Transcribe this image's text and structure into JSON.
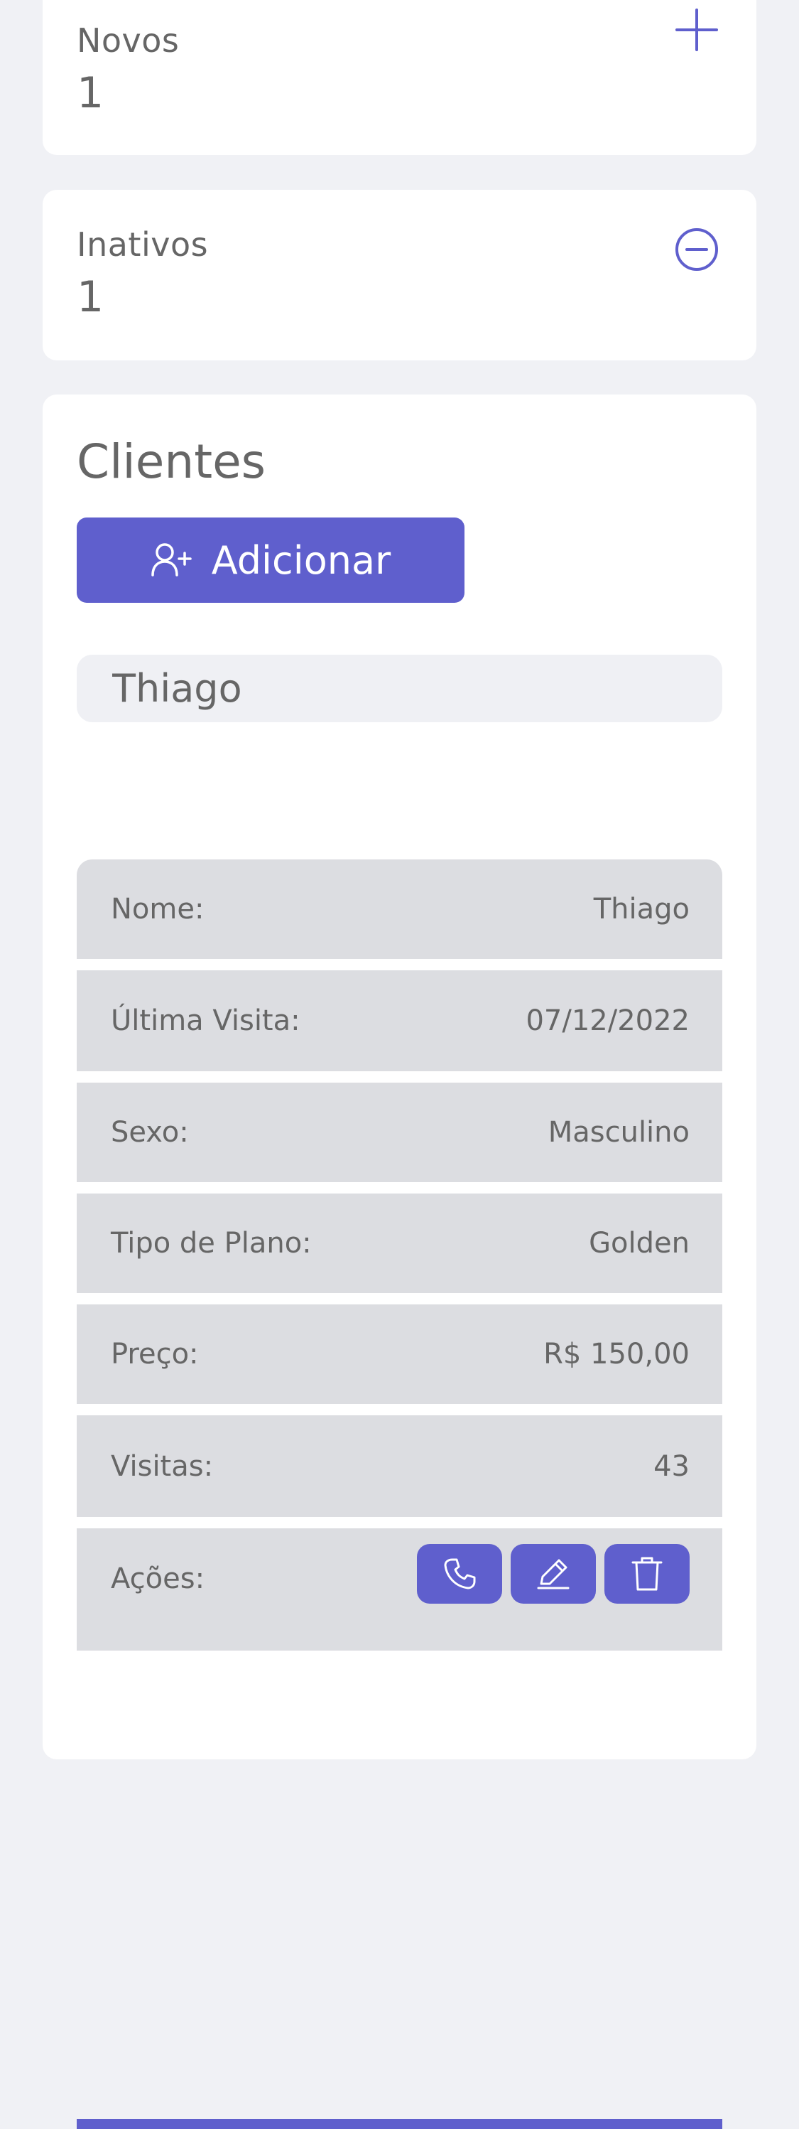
{
  "stats": {
    "novos": {
      "label": "Novos",
      "value": "1",
      "icon": "plus-icon"
    },
    "inativos": {
      "label": "Inativos",
      "value": "1",
      "icon": "minus-circle-icon"
    }
  },
  "clientes": {
    "title": "Clientes",
    "add_button": {
      "label": "Adicionar",
      "icon": "user-plus-icon"
    },
    "search": {
      "value": "Thiago"
    },
    "details": {
      "nome": {
        "label": "Nome:",
        "value": "Thiago"
      },
      "ultima_visita": {
        "label": "Última Visita:",
        "value": "07/12/2022"
      },
      "sexo": {
        "label": "Sexo:",
        "value": "Masculino"
      },
      "tipo_plano": {
        "label": "Tipo de Plano:",
        "value": "Golden"
      },
      "preco": {
        "label": "Preço:",
        "value": "R$ 150,00"
      },
      "visitas": {
        "label": "Visitas:",
        "value": "43"
      },
      "acoes": {
        "label": "Ações:",
        "buttons": [
          "phone-icon",
          "pencil-icon",
          "trash-icon"
        ]
      }
    }
  },
  "colors": {
    "accent": "#5f5fcd",
    "background": "#f0f1f5",
    "card": "#ffffff",
    "row": "#dcdde1",
    "text": "#666666"
  }
}
